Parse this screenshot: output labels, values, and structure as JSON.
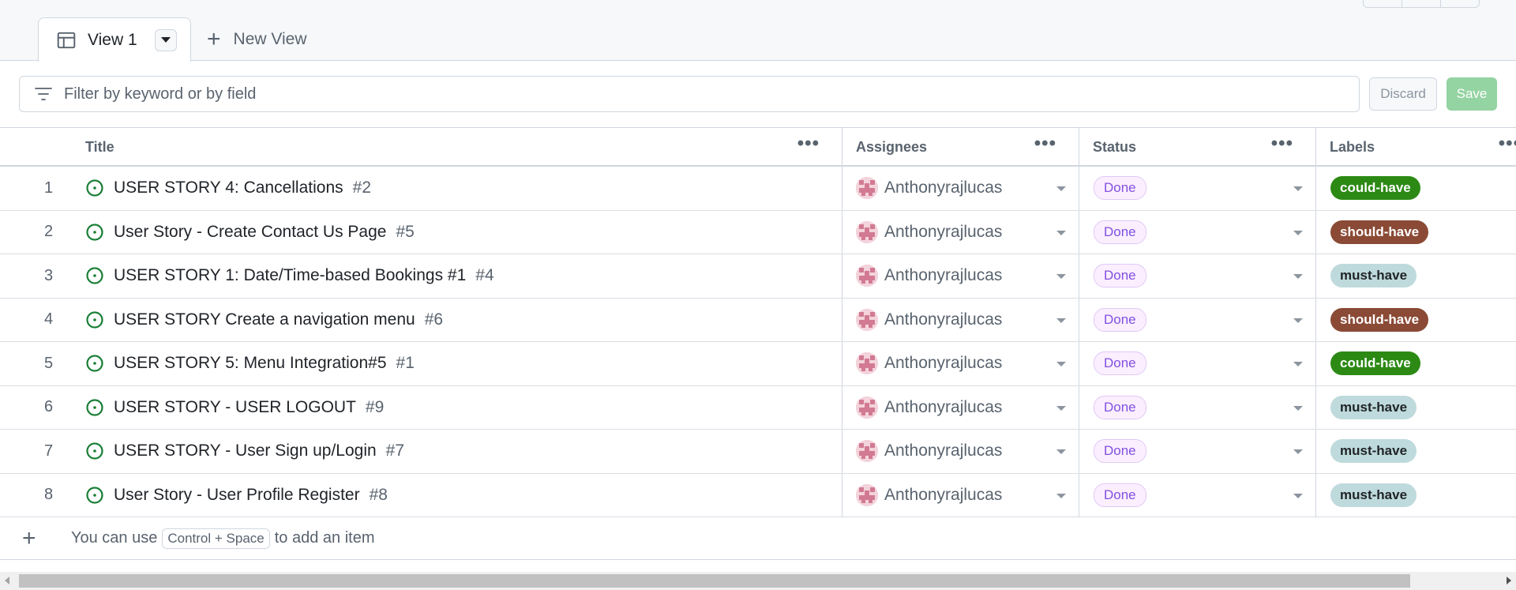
{
  "tabs": [
    {
      "label": "View 1",
      "icon": "table-icon",
      "active": true
    },
    {
      "label": "New View",
      "icon": "plus-icon",
      "active": false
    }
  ],
  "filter": {
    "placeholder": "Filter by keyword or by field",
    "icon": "filter-icon"
  },
  "actions": {
    "discard": "Discard",
    "save": "Save"
  },
  "columns": [
    {
      "label": "Title"
    },
    {
      "label": "Assignees"
    },
    {
      "label": "Status"
    },
    {
      "label": "Labels"
    }
  ],
  "rows": [
    {
      "n": "1",
      "title": "USER STORY 4: Cancellations",
      "issue": "#2",
      "assignee": "Anthonyrajlucas",
      "status": "Done",
      "label": "could-have"
    },
    {
      "n": "2",
      "title": "User Story - Create Contact Us Page",
      "issue": "#5",
      "assignee": "Anthonyrajlucas",
      "status": "Done",
      "label": "should-have"
    },
    {
      "n": "3",
      "title": "USER STORY 1: Date/Time-based Bookings #1",
      "issue": "#4",
      "assignee": "Anthonyrajlucas",
      "status": "Done",
      "label": "must-have"
    },
    {
      "n": "4",
      "title": "USER STORY Create a navigation menu",
      "issue": "#6",
      "assignee": "Anthonyrajlucas",
      "status": "Done",
      "label": "should-have"
    },
    {
      "n": "5",
      "title": "USER STORY 5: Menu Integration#5",
      "issue": "#1",
      "assignee": "Anthonyrajlucas",
      "status": "Done",
      "label": "could-have"
    },
    {
      "n": "6",
      "title": "USER STORY - USER LOGOUT",
      "issue": "#9",
      "assignee": "Anthonyrajlucas",
      "status": "Done",
      "label": "must-have"
    },
    {
      "n": "7",
      "title": "USER STORY - User Sign up/Login",
      "issue": "#7",
      "assignee": "Anthonyrajlucas",
      "status": "Done",
      "label": "must-have"
    },
    {
      "n": "8",
      "title": "User Story - User Profile Register",
      "issue": "#8",
      "assignee": "Anthonyrajlucas",
      "status": "Done",
      "label": "must-have"
    }
  ],
  "label_colors": {
    "could-have": {
      "bg": "#2c8a14",
      "fg": "#ffffff"
    },
    "should-have": {
      "bg": "#8a4a35",
      "fg": "#ffffff"
    },
    "must-have": {
      "bg": "#bfdadc",
      "fg": "#1f2328"
    }
  },
  "add_item": {
    "prefix": "You can use",
    "shortcut": "Control + Space",
    "suffix": "to add an item"
  },
  "colors": {
    "open_issue": "#1a7f37",
    "status_done": "#8250df",
    "save_disabled": "#94d3a2"
  }
}
